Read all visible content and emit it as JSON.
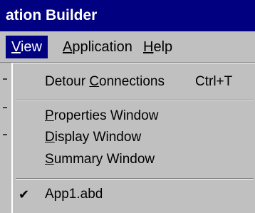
{
  "title_bar": {
    "title": "ation Builder",
    "background": "#000080"
  },
  "menu_bar": {
    "items": [
      {
        "underline": "V",
        "rest": "iew",
        "selected": true
      },
      {
        "underline": "A",
        "rest": "pplication",
        "selected": false
      },
      {
        "underline": "H",
        "rest": "elp",
        "selected": false
      }
    ]
  },
  "view_menu": {
    "detour": {
      "prefix": "Detour ",
      "underline": "C",
      "rest": "onnections",
      "shortcut": "Ctrl+T"
    },
    "windows": [
      {
        "underline": "P",
        "rest": "roperties Window"
      },
      {
        "underline": "D",
        "rest": "isplay Window"
      },
      {
        "underline": "S",
        "rest": "ummary Window"
      }
    ],
    "file": {
      "label": "App1.abd",
      "checked": true,
      "check_icon": "checkmark-icon"
    }
  }
}
